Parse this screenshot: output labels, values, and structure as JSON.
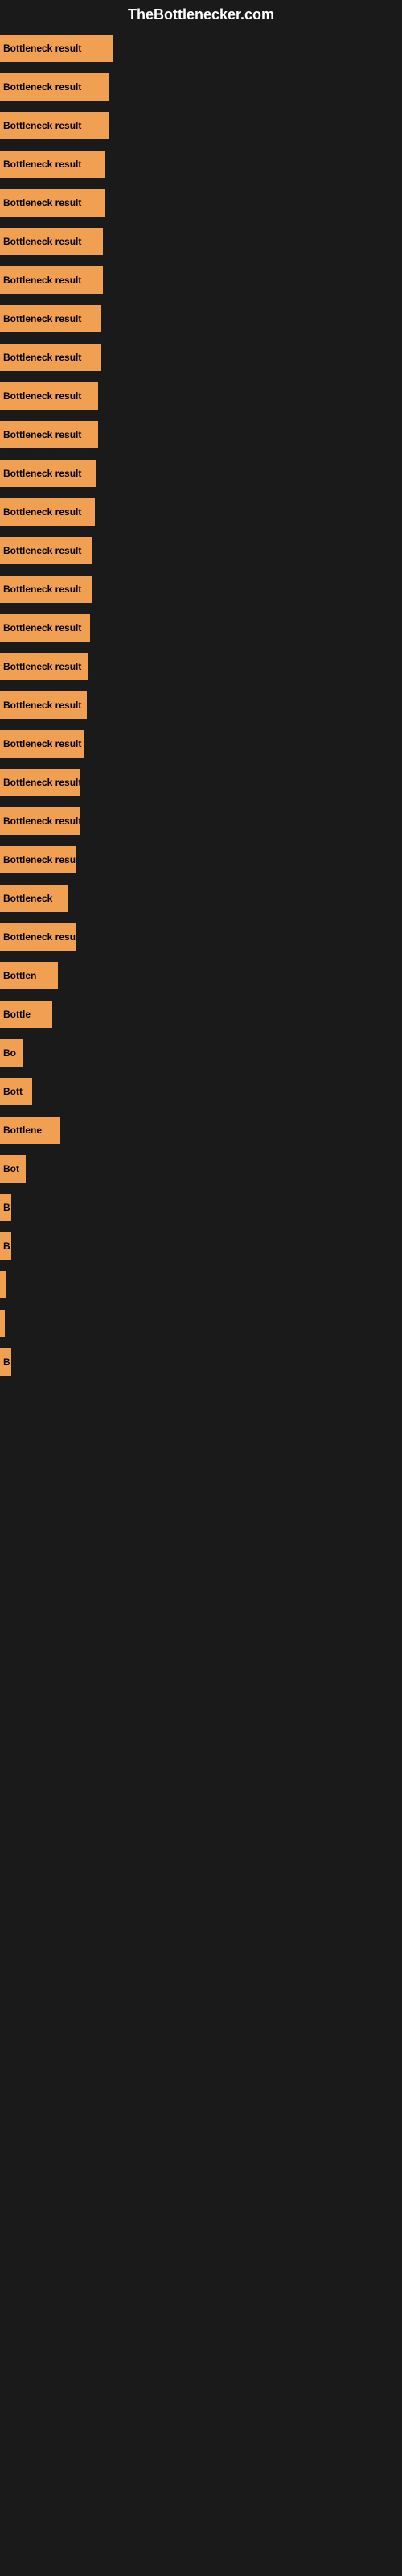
{
  "site": {
    "title": "TheBottlenecker.com"
  },
  "bars": [
    {
      "label": "Bottleneck result",
      "width": 140
    },
    {
      "label": "Bottleneck result",
      "width": 135
    },
    {
      "label": "Bottleneck result",
      "width": 135
    },
    {
      "label": "Bottleneck result",
      "width": 130
    },
    {
      "label": "Bottleneck result",
      "width": 130
    },
    {
      "label": "Bottleneck result",
      "width": 128
    },
    {
      "label": "Bottleneck result",
      "width": 128
    },
    {
      "label": "Bottleneck result",
      "width": 125
    },
    {
      "label": "Bottleneck result",
      "width": 125
    },
    {
      "label": "Bottleneck result",
      "width": 122
    },
    {
      "label": "Bottleneck result",
      "width": 122
    },
    {
      "label": "Bottleneck result",
      "width": 120
    },
    {
      "label": "Bottleneck result",
      "width": 118
    },
    {
      "label": "Bottleneck result",
      "width": 115
    },
    {
      "label": "Bottleneck result",
      "width": 115
    },
    {
      "label": "Bottleneck result",
      "width": 112
    },
    {
      "label": "Bottleneck result",
      "width": 110
    },
    {
      "label": "Bottleneck result",
      "width": 108
    },
    {
      "label": "Bottleneck result",
      "width": 105
    },
    {
      "label": "Bottleneck result",
      "width": 100
    },
    {
      "label": "Bottleneck result",
      "width": 100
    },
    {
      "label": "Bottleneck result",
      "width": 95
    },
    {
      "label": "Bottleneck",
      "width": 85
    },
    {
      "label": "Bottleneck result",
      "width": 95
    },
    {
      "label": "Bottlen",
      "width": 72
    },
    {
      "label": "Bottle",
      "width": 65
    },
    {
      "label": "Bo",
      "width": 28
    },
    {
      "label": "Bott",
      "width": 40
    },
    {
      "label": "Bottlene",
      "width": 75
    },
    {
      "label": "Bot",
      "width": 32
    },
    {
      "label": "B",
      "width": 14
    },
    {
      "label": "B",
      "width": 14
    },
    {
      "label": "",
      "width": 8
    },
    {
      "label": "",
      "width": 6
    },
    {
      "label": "B",
      "width": 14
    }
  ]
}
